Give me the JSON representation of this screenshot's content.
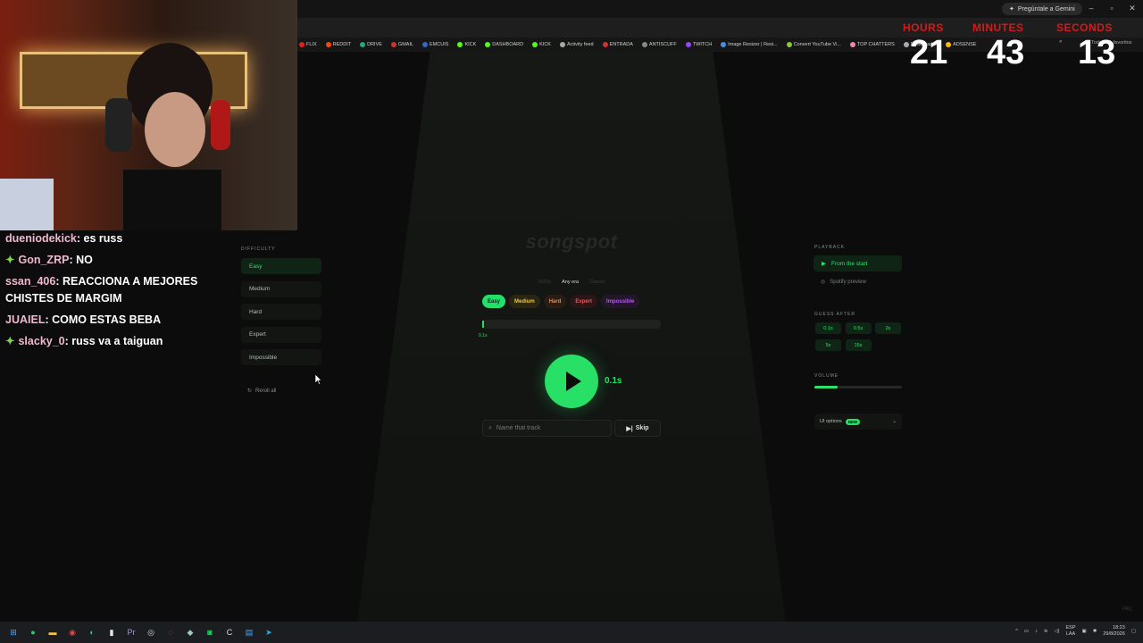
{
  "browser": {
    "gemini_label": "Pregúntale a Gemini",
    "bookmarks": [
      {
        "label": "FLIX",
        "color": "#d22"
      },
      {
        "label": "REDDIT",
        "color": "#ff4500"
      },
      {
        "label": "DRIVE",
        "color": "#2a7"
      },
      {
        "label": "GMAIL",
        "color": "#c33"
      },
      {
        "label": "EMCUIS",
        "color": "#36c"
      },
      {
        "label": "KICK",
        "color": "#53fc18"
      },
      {
        "label": "DASHBOARD",
        "color": "#53fc18"
      },
      {
        "label": "KICK",
        "color": "#53fc18"
      },
      {
        "label": "Activity feed",
        "color": "#aaa"
      },
      {
        "label": "ENTRADA",
        "color": "#c33"
      },
      {
        "label": "ANTISCUFF",
        "color": "#888"
      },
      {
        "label": "TWITCH",
        "color": "#9146ff"
      },
      {
        "label": "Image Resizer | Resi...",
        "color": "#4a90e2"
      },
      {
        "label": "Convert YouTube Vi...",
        "color": "#8c3"
      },
      {
        "label": "TOP CHATTERS",
        "color": "#e8a"
      },
      {
        "label": "Downloader",
        "color": "#aaa"
      },
      {
        "label": "ADSENSE",
        "color": "#fbbc05"
      }
    ],
    "bookmarks_more": "»",
    "favorites_label": "Todos los favoritos"
  },
  "timer": {
    "hours_label": "HOURS",
    "minutes_label": "MINUTES",
    "seconds_label": "SECONDS",
    "hours": "21",
    "minutes": "43",
    "seconds": "13",
    "label_color": "#d31b1b"
  },
  "chat": [
    {
      "user": "dueniodekick",
      "message": "es russ",
      "badge": ""
    },
    {
      "user": "Gon_ZRP",
      "message": "NO",
      "badge": "✦"
    },
    {
      "user": "ssan_406",
      "message": "REACCIONA A MEJORES CHISTES DE MARGIM",
      "badge": ""
    },
    {
      "user": "JUAIEL",
      "message": "COMO ESTAS BEBA",
      "badge": ""
    },
    {
      "user": "slacky_0",
      "message": "russ va a taiguan",
      "badge": "✦"
    }
  ],
  "app": {
    "logo": "songspot",
    "eras": [
      {
        "label": "2020s",
        "active": false
      },
      {
        "label": "Any era",
        "active": true
      },
      {
        "label": "Classic",
        "active": false
      }
    ],
    "difficulty_chips": [
      {
        "label": "Easy",
        "bg": "#22e06a",
        "fg": "#0b2a14"
      },
      {
        "label": "Medium",
        "bg": "#2a2614",
        "fg": "#e8c64a"
      },
      {
        "label": "Hard",
        "bg": "#2a1b14",
        "fg": "#e8884a"
      },
      {
        "label": "Expert",
        "bg": "#2a1616",
        "fg": "#e85a5a"
      },
      {
        "label": "Impossible",
        "bg": "#24162a",
        "fg": "#b45ae8"
      }
    ],
    "progress": {
      "label": "0.1s",
      "fraction": 0.01
    },
    "play_time": "0.1s",
    "search_placeholder": "Name that track",
    "skip_label": "Skip",
    "accent": "#22e06a"
  },
  "left_panel": {
    "title": "DIFFICULTY",
    "items": [
      {
        "label": "Easy",
        "active": true
      },
      {
        "label": "Medium",
        "active": false
      },
      {
        "label": "Hard",
        "active": false
      },
      {
        "label": "Expert",
        "active": false
      },
      {
        "label": "Impossible",
        "active": false
      }
    ],
    "reroll_label": "Reroll all"
  },
  "right_panel": {
    "playback_title": "PLAYBACK",
    "from_start_label": "From the start",
    "spotify_label": "Spotify preview",
    "guess_title": "GUESS AFTER",
    "guess_options": [
      "0.1s",
      "0.5s",
      "2s",
      "5s",
      "15s"
    ],
    "volume_title": "VOLUME",
    "volume_fraction": 0.27,
    "ui_options_label": "UI options",
    "new_badge": "NEW"
  },
  "faq_label": "FAQ",
  "taskbar": {
    "icons": [
      {
        "name": "windows-start-icon",
        "glyph": "⊞",
        "color": "#4aa8ff"
      },
      {
        "name": "spotify-icon",
        "glyph": "●",
        "color": "#1ed760"
      },
      {
        "name": "file-explorer-icon",
        "glyph": "▬",
        "color": "#f5c542"
      },
      {
        "name": "chrome-icon",
        "glyph": "◉",
        "color": "#e8453c"
      },
      {
        "name": "edge-icon",
        "glyph": "◐",
        "color": "#3ac0a0"
      },
      {
        "name": "document-icon",
        "glyph": "▮",
        "color": "#e8e8e8"
      },
      {
        "name": "premiere-icon",
        "glyph": "Pr",
        "color": "#9999ff"
      },
      {
        "name": "obs-icon",
        "glyph": "◎",
        "color": "#ddd"
      },
      {
        "name": "capture-icon",
        "glyph": "◌",
        "color": "#e55"
      },
      {
        "name": "steam-icon",
        "glyph": "◆",
        "color": "#9cc"
      },
      {
        "name": "whatsapp-icon",
        "glyph": "◙",
        "color": "#25d366"
      },
      {
        "name": "ccleaner-icon",
        "glyph": "C",
        "color": "#ddd"
      },
      {
        "name": "notepad-icon",
        "glyph": "▤",
        "color": "#4aa8ff"
      },
      {
        "name": "telegram-icon",
        "glyph": "➤",
        "color": "#2aabee"
      }
    ],
    "lang_top": "ESP",
    "lang_bottom": "LAA",
    "time": "18:23",
    "date": "29/8/2026"
  }
}
